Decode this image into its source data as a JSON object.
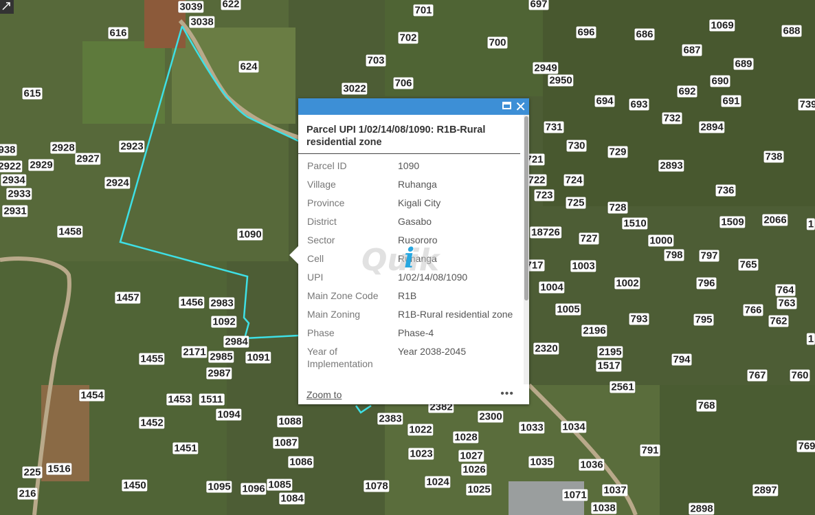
{
  "colors": {
    "parcel_outline": "#3ee0e6",
    "popup_header": "#3d8fd6",
    "road": "#b9a98a"
  },
  "map_labels": [
    [
      "3039",
      278,
      10
    ],
    [
      "622",
      336,
      6
    ],
    [
      "3038",
      294,
      32
    ],
    [
      "616",
      172,
      48
    ],
    [
      "701",
      616,
      15
    ],
    [
      "697",
      784,
      6
    ],
    [
      "702",
      594,
      55
    ],
    [
      "700",
      724,
      62
    ],
    [
      "703",
      547,
      88
    ],
    [
      "624",
      362,
      97
    ],
    [
      "696",
      853,
      47
    ],
    [
      "686",
      938,
      50
    ],
    [
      "1069",
      1051,
      37
    ],
    [
      "688",
      1152,
      45
    ],
    [
      "687",
      1007,
      73
    ],
    [
      "689",
      1082,
      93
    ],
    [
      "2949",
      794,
      99
    ],
    [
      "2950",
      816,
      117
    ],
    [
      "3022",
      516,
      129
    ],
    [
      "706",
      587,
      121
    ],
    [
      "615",
      47,
      136
    ],
    [
      "690",
      1048,
      118
    ],
    [
      "692",
      1000,
      133
    ],
    [
      "691",
      1064,
      147
    ],
    [
      "694",
      880,
      147
    ],
    [
      "693",
      930,
      152
    ],
    [
      "739",
      1176,
      152
    ],
    [
      "732",
      978,
      172
    ],
    [
      "2894",
      1036,
      185
    ],
    [
      "731",
      806,
      185
    ],
    [
      "730",
      839,
      212
    ],
    [
      "729",
      899,
      221
    ],
    [
      "738",
      1126,
      228
    ],
    [
      "2928",
      92,
      215
    ],
    [
      "2927",
      128,
      231
    ],
    [
      "2923",
      192,
      213
    ],
    [
      "938",
      10,
      218
    ],
    [
      "2922",
      14,
      242
    ],
    [
      "2929",
      60,
      240
    ],
    [
      "2934",
      20,
      262
    ],
    [
      "2933",
      28,
      282
    ],
    [
      "2931",
      22,
      307
    ],
    [
      "2924",
      171,
      266
    ],
    [
      "721",
      778,
      232
    ],
    [
      "722",
      781,
      262
    ],
    [
      "724",
      835,
      262
    ],
    [
      "2893",
      977,
      241
    ],
    [
      "723",
      792,
      284
    ],
    [
      "725",
      838,
      295
    ],
    [
      "736",
      1056,
      277
    ],
    [
      "728",
      899,
      302
    ],
    [
      "1510",
      924,
      325
    ],
    [
      "1509",
      1066,
      323
    ],
    [
      "2066",
      1128,
      320
    ],
    [
      "1458",
      102,
      337
    ],
    [
      "1090",
      364,
      341
    ],
    [
      "18726",
      794,
      338
    ],
    [
      "727",
      857,
      347
    ],
    [
      "1000",
      962,
      350
    ],
    [
      "1",
      1180,
      326
    ],
    [
      "798",
      981,
      371
    ],
    [
      "797",
      1032,
      372
    ],
    [
      "717",
      778,
      386
    ],
    [
      "1003",
      849,
      387
    ],
    [
      "765",
      1089,
      385
    ],
    [
      "1004",
      803,
      418
    ],
    [
      "1002",
      913,
      412
    ],
    [
      "796",
      1028,
      412
    ],
    [
      "764",
      1143,
      422
    ],
    [
      "763",
      1145,
      441
    ],
    [
      "1457",
      186,
      433
    ],
    [
      "1456",
      279,
      440
    ],
    [
      "2983",
      323,
      441
    ],
    [
      "1005",
      827,
      450
    ],
    [
      "766",
      1096,
      451
    ],
    [
      "762",
      1133,
      467
    ],
    [
      "793",
      930,
      464
    ],
    [
      "795",
      1024,
      465
    ],
    [
      "1092",
      326,
      468
    ],
    [
      "2196",
      865,
      481
    ],
    [
      "1",
      1180,
      493
    ],
    [
      "2984",
      344,
      497
    ],
    [
      "1455",
      221,
      522
    ],
    [
      "2171",
      283,
      512
    ],
    [
      "2985",
      322,
      519
    ],
    [
      "1091",
      376,
      520
    ],
    [
      "2320",
      795,
      507
    ],
    [
      "2195",
      888,
      512
    ],
    [
      "1517",
      886,
      532
    ],
    [
      "794",
      992,
      523
    ],
    [
      "767",
      1102,
      546
    ],
    [
      "760",
      1164,
      546
    ],
    [
      "2987",
      319,
      543
    ],
    [
      "2561",
      906,
      563
    ],
    [
      "1454",
      134,
      575
    ],
    [
      "1453",
      261,
      581
    ],
    [
      "1511",
      308,
      581
    ],
    [
      "1094",
      333,
      603
    ],
    [
      "2382",
      642,
      592
    ],
    [
      "2300",
      714,
      606
    ],
    [
      "2383",
      568,
      609
    ],
    [
      "768",
      1028,
      590
    ],
    [
      "1452",
      221,
      615
    ],
    [
      "1088",
      422,
      613
    ],
    [
      "1022",
      612,
      625
    ],
    [
      "1028",
      678,
      636
    ],
    [
      "1033",
      774,
      622
    ],
    [
      "1034",
      835,
      621
    ],
    [
      "769",
      1174,
      649
    ],
    [
      "1451",
      270,
      652
    ],
    [
      "1087",
      416,
      644
    ],
    [
      "791",
      946,
      655
    ],
    [
      "1023",
      613,
      660
    ],
    [
      "1027",
      686,
      663
    ],
    [
      "1035",
      788,
      672
    ],
    [
      "1036",
      861,
      676
    ],
    [
      "1516",
      86,
      682
    ],
    [
      "225",
      47,
      687
    ],
    [
      "1086",
      438,
      672
    ],
    [
      "1026",
      690,
      683
    ],
    [
      "1450",
      196,
      706
    ],
    [
      "1095",
      319,
      708
    ],
    [
      "1096",
      369,
      711
    ],
    [
      "1085",
      407,
      705
    ],
    [
      "1078",
      548,
      707
    ],
    [
      "1024",
      637,
      701
    ],
    [
      "1025",
      697,
      712
    ],
    [
      "1071",
      837,
      720
    ],
    [
      "1037",
      895,
      713
    ],
    [
      "2897",
      1114,
      713
    ],
    [
      "216",
      40,
      718
    ],
    [
      "1084",
      425,
      725
    ],
    [
      "1038",
      879,
      739
    ],
    [
      "2898",
      1021,
      740
    ]
  ],
  "popup": {
    "title": "Parcel UPI 1/02/14/08/1090: R1B-Rural residential zone",
    "fields": [
      {
        "label": "Parcel ID",
        "value": "1090"
      },
      {
        "label": "Village",
        "value": "Ruhanga"
      },
      {
        "label": "Province",
        "value": "Kigali City"
      },
      {
        "label": "District",
        "value": "Gasabo"
      },
      {
        "label": "Sector",
        "value": "Rusororo"
      },
      {
        "label": "Cell",
        "value": "Ruhanga"
      },
      {
        "label": "UPI",
        "value": "1/02/14/08/1090"
      },
      {
        "label": "Main Zone Code",
        "value": "R1B"
      },
      {
        "label": "Main Zoning",
        "value": "R1B-Rural residential zone"
      },
      {
        "label": "Phase",
        "value": "Phase-4"
      },
      {
        "label": "Year of Implementation",
        "value": "Year 2038-2045"
      }
    ],
    "zoom_label": "Zoom to",
    "more_label": "•••",
    "close_glyph": "✕",
    "maximize_icon": "maximize-icon",
    "watermark": "Quik"
  }
}
